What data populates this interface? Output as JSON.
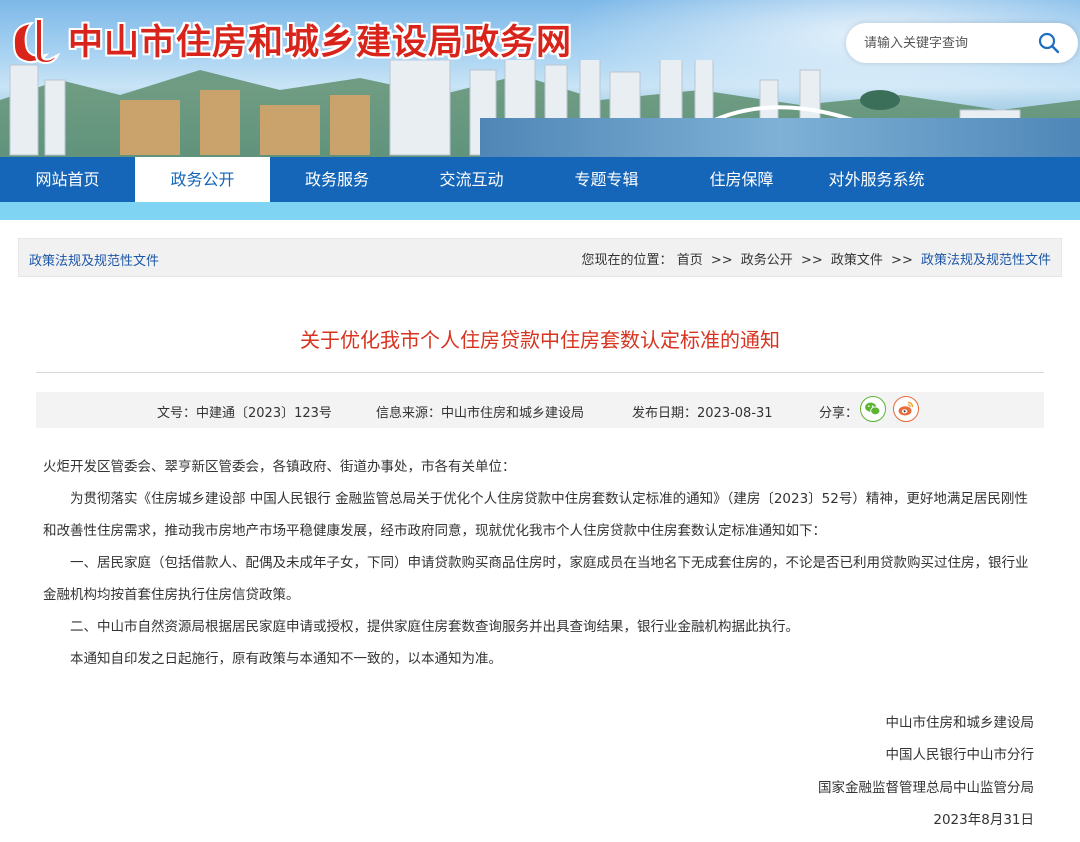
{
  "header": {
    "site_title": "中山市住房和城乡建设局政务网",
    "search_placeholder": "请输入关键字查询"
  },
  "nav": {
    "items": [
      {
        "label": "网站首页"
      },
      {
        "label": "政务公开",
        "active": true
      },
      {
        "label": "政务服务"
      },
      {
        "label": "交流互动"
      },
      {
        "label": "专题专辑"
      },
      {
        "label": "住房保障"
      },
      {
        "label": "对外服务系统"
      }
    ]
  },
  "breadcrumb": {
    "section": "政策法规及规范性文件",
    "prefix": "您现在的位置：",
    "items": [
      "首页",
      "政务公开",
      "政策文件",
      "政策法规及规范性文件"
    ],
    "separator": ">>"
  },
  "article": {
    "title": "关于优化我市个人住房贷款中住房套数认定标准的通知",
    "meta": {
      "doc_no": "文号：中建通〔2023〕123号",
      "source": "信息来源：中山市住房和城乡建设局",
      "date": "发布日期：2023-08-31",
      "share_label": "分享："
    },
    "paragraphs": [
      "火炬开发区管委会、翠亨新区管委会，各镇政府、街道办事处，市各有关单位：",
      "为贯彻落实《住房城乡建设部 中国人民银行 金融监管总局关于优化个人住房贷款中住房套数认定标准的通知》（建房〔2023〕52号）精神，更好地满足居民刚性和改善性住房需求，推动我市房地产市场平稳健康发展，经市政府同意，现就优化我市个人住房贷款中住房套数认定标准通知如下：",
      "一、居民家庭（包括借款人、配偶及未成年子女，下同）申请贷款购买商品住房时，家庭成员在当地名下无成套住房的，不论是否已利用贷款购买过住房，银行业金融机构均按首套住房执行住房信贷政策。",
      "二、中山市自然资源局根据居民家庭申请或授权，提供家庭住房套数查询服务并出具查询结果，银行业金融机构据此执行。",
      "本通知自印发之日起施行，原有政策与本通知不一致的，以本通知为准。"
    ],
    "signatures": [
      "中山市住房和城乡建设局",
      "中国人民银行中山市分行",
      "国家金融监督管理总局中山监管分局",
      "2023年8月31日"
    ]
  },
  "colors": {
    "nav_bg": "#1566b8",
    "nav_strip": "#7fd3f3",
    "title_red": "#d8331f",
    "link_blue": "#1c56a8",
    "wechat_green": "#5cb531",
    "weibo_orange": "#e8693a"
  },
  "icons": {
    "search": "search-icon",
    "wechat": "wechat-icon",
    "weibo": "weibo-icon",
    "logo": "logo-icon"
  }
}
